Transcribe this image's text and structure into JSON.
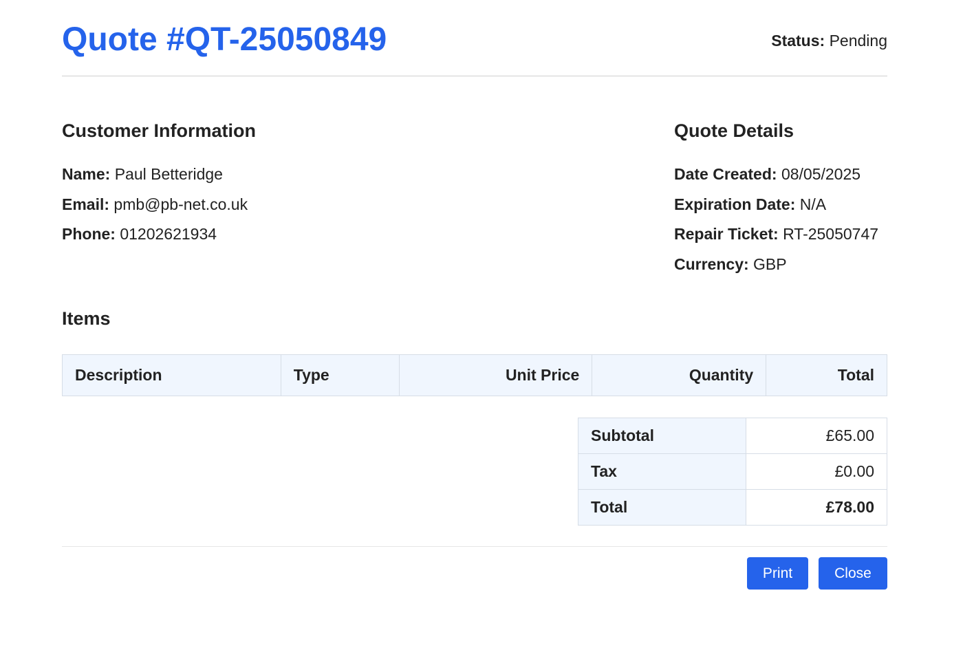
{
  "header": {
    "title": "Quote #QT-25050849",
    "status_label": "Status:",
    "status_value": "Pending"
  },
  "customer": {
    "heading": "Customer Information",
    "name_label": "Name:",
    "name_value": "Paul Betteridge",
    "email_label": "Email:",
    "email_value": "pmb@pb-net.co.uk",
    "phone_label": "Phone:",
    "phone_value": "01202621934"
  },
  "details": {
    "heading": "Quote Details",
    "date_label": "Date Created:",
    "date_value": "08/05/2025",
    "expiration_label": "Expiration Date:",
    "expiration_value": "N/A",
    "ticket_label": "Repair Ticket:",
    "ticket_value": "RT-25050747",
    "currency_label": "Currency:",
    "currency_value": "GBP"
  },
  "items": {
    "heading": "Items",
    "columns": [
      "Description",
      "Type",
      "Unit Price",
      "Quantity",
      "Total"
    ],
    "rows": []
  },
  "summary": {
    "subtotal_label": "Subtotal",
    "subtotal_value": "£65.00",
    "tax_label": "Tax",
    "tax_value": "£0.00",
    "total_label": "Total",
    "total_value": "£78.00"
  },
  "buttons": {
    "print_label": "Print",
    "close_label": "Close"
  },
  "colors": {
    "accent": "#2563eb",
    "table_header_bg": "#f0f6fe"
  }
}
